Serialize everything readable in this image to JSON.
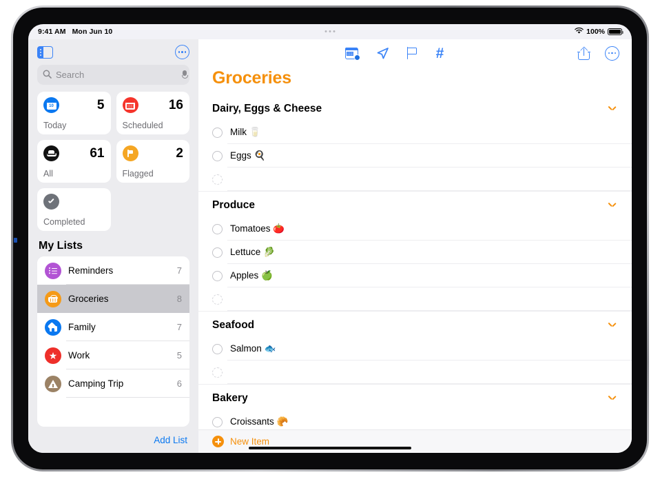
{
  "status_bar": {
    "time": "9:41 AM",
    "date": "Mon Jun 10",
    "battery_percent": "100%",
    "wifi_icon": "wifi-icon",
    "battery_icon": "battery-icon"
  },
  "sidebar": {
    "toggle_icon": "sidebar-toggle-icon",
    "more_icon": "more-options-icon",
    "search": {
      "placeholder": "Search",
      "value": "",
      "search_icon": "search-icon",
      "mic_icon": "microphone-icon"
    },
    "smart_lists": [
      {
        "label": "Today",
        "count": "5",
        "icon": "calendar-today-icon",
        "icon_color": "#0a78f0",
        "day_number": "10"
      },
      {
        "label": "Scheduled",
        "count": "16",
        "icon": "calendar-scheduled-icon",
        "icon_color": "#f5342b"
      },
      {
        "label": "All",
        "count": "61",
        "icon": "inbox-tray-icon",
        "icon_color": "#111111"
      },
      {
        "label": "Flagged",
        "count": "2",
        "icon": "flag-icon",
        "icon_color": "#f5a623"
      },
      {
        "label": "Completed",
        "count": "",
        "icon": "checkmark-circle-icon",
        "icon_color": "#6e7279"
      }
    ],
    "my_lists_header": "My Lists",
    "lists": [
      {
        "name": "Reminders",
        "count": "7",
        "icon": "bulleted-list-icon",
        "icon_color": "#b254d4",
        "selected": false
      },
      {
        "name": "Groceries",
        "count": "8",
        "icon": "shopping-basket-icon",
        "icon_color": "#f59a17",
        "selected": true
      },
      {
        "name": "Family",
        "count": "7",
        "icon": "house-icon",
        "icon_color": "#0a78f0",
        "selected": false
      },
      {
        "name": "Work",
        "count": "5",
        "icon": "star-icon",
        "icon_color": "#ee2f2a",
        "selected": false
      },
      {
        "name": "Camping Trip",
        "count": "6",
        "icon": "tent-icon",
        "icon_color": "#9b8265",
        "selected": false
      }
    ],
    "add_list_label": "Add List"
  },
  "main": {
    "toolbar": [
      {
        "name": "add-date-button",
        "icon": "calendar-clock-icon"
      },
      {
        "name": "add-location-button",
        "icon": "location-arrow-icon"
      },
      {
        "name": "add-flag-button",
        "icon": "flag-outline-icon"
      },
      {
        "name": "add-tag-button",
        "icon": "hashtag-icon",
        "glyph": "#"
      }
    ],
    "share_icon": "share-icon",
    "more_icon": "more-options-icon",
    "title": "Groceries",
    "title_color": "#f5900c",
    "sections": [
      {
        "title": "Dairy, Eggs & Cheese",
        "collapse_icon": "chevron-down-icon",
        "items": [
          {
            "text": "Milk 🥛",
            "completed": false
          },
          {
            "text": "Eggs 🍳",
            "completed": false
          },
          {
            "text": "",
            "placeholder_row": true
          }
        ]
      },
      {
        "title": "Produce",
        "collapse_icon": "chevron-down-icon",
        "items": [
          {
            "text": "Tomatoes 🍅",
            "completed": false
          },
          {
            "text": "Lettuce 🥬",
            "completed": false
          },
          {
            "text": "Apples 🍏",
            "completed": false
          },
          {
            "text": "",
            "placeholder_row": true
          }
        ]
      },
      {
        "title": "Seafood",
        "collapse_icon": "chevron-down-icon",
        "items": [
          {
            "text": "Salmon 🐟",
            "completed": false
          },
          {
            "text": "",
            "placeholder_row": true
          }
        ]
      },
      {
        "title": "Bakery",
        "collapse_icon": "chevron-down-icon",
        "items": [
          {
            "text": "Croissants 🥐",
            "completed": false
          }
        ]
      }
    ],
    "new_item": {
      "label": "New Item",
      "icon": "plus-circle-icon",
      "color": "#f5900c"
    }
  }
}
